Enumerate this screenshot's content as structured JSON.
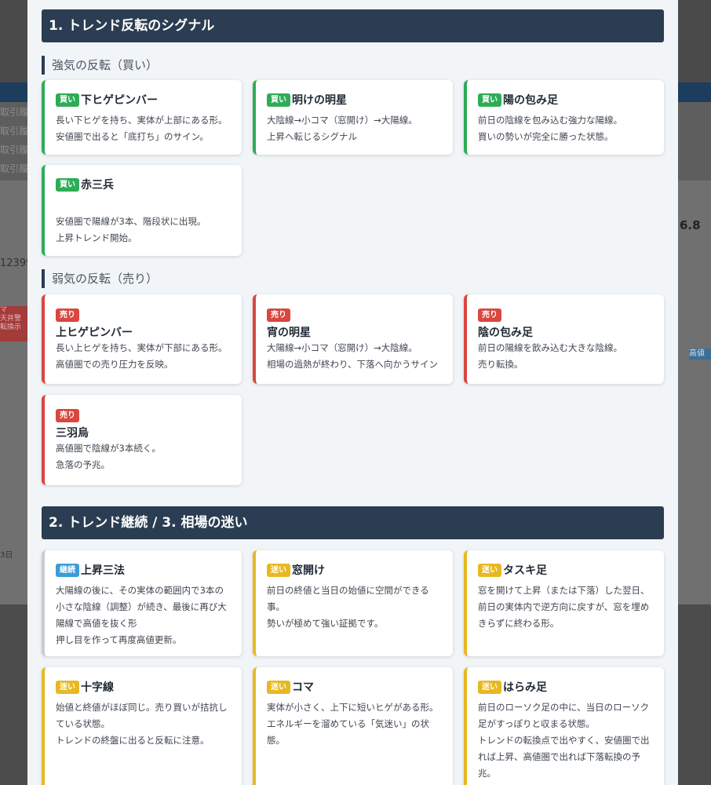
{
  "background": {
    "rows": [
      "取引履",
      "取引履",
      "取引履",
      "取引履"
    ],
    "left_number": "12399",
    "right_value": "6.8",
    "date_label": "3日",
    "left_tags": [
      "マ",
      "天井警",
      "転換示"
    ],
    "right_tag": "高値"
  },
  "section1": {
    "title": "1. トレンド反転のシグナル",
    "bull_heading": "強気の反転（買い）",
    "bear_heading": "弱気の反転（売り）"
  },
  "bull_cards": [
    {
      "badge": "買い",
      "title": "下ヒゲピンバー",
      "desc": "長い下ヒゲを持ち、実体が上部にある形。\n安値圏で出ると「底打ち」のサイン。"
    },
    {
      "badge": "買い",
      "title": "明けの明星",
      "desc": "大陰線→小コマ（窓開け）→大陽線。\n上昇へ転じるシグナル"
    },
    {
      "badge": "買い",
      "title": "陽の包み足",
      "desc": "前日の陰線を包み込む強力な陽線。\n買いの勢いが完全に勝った状態。"
    },
    {
      "badge": "買い",
      "title": "赤三兵",
      "desc": "安値圏で陽線が3本、階段状に出現。\n上昇トレンド開始。"
    }
  ],
  "bear_cards": [
    {
      "badge": "売り",
      "title": "上ヒゲピンバー",
      "desc": "長い上ヒゲを持ち、実体が下部にある形。\n高値圏での売り圧力を反映。"
    },
    {
      "badge": "売り",
      "title": "宵の明星",
      "desc": "大陽線→小コマ（窓開け）→大陰線。\n相場の過熱が終わり、下落へ向かうサイン"
    },
    {
      "badge": "売り",
      "title": "陰の包み足",
      "desc": "前日の陽線を飲み込む大きな陰線。\n売り転換。"
    },
    {
      "badge": "売り",
      "title": "三羽烏",
      "desc": "高値圏で陰線が3本続く。\n急落の予兆。"
    }
  ],
  "section2": {
    "title": "2. トレンド継続 / 3. 相場の迷い"
  },
  "other_cards": [
    {
      "badge": "継続",
      "title": "上昇三法",
      "desc": "大陽線の後に、その実体の範囲内で3本の\n小さな陰線（調整）が続き、最後に再び大\n陽線で高値を抜く形\n押し目を作って再度高値更新。"
    },
    {
      "badge": "迷い",
      "title": "窓開け",
      "desc": "前日の終値と当日の始値に空間ができる\n事。\n勢いが極めて強い証拠です。"
    },
    {
      "badge": "迷い",
      "title": "タスキ足",
      "desc": "窓を開けて上昇（または下落）した翌日、\n前日の実体内で逆方向に戻すが、窓を埋め\nきらずに終わる形。"
    },
    {
      "badge": "迷い",
      "title": "十字線",
      "desc": "始値と終値がほぼ同じ。売り買いが拮抗し\nている状態。\nトレンドの終盤に出ると反転に注意。"
    },
    {
      "badge": "迷い",
      "title": "コマ",
      "desc": "実体が小さく、上下に短いヒゲがある形。\nエネルギーを溜めている「気迷い」の状\n態。"
    },
    {
      "badge": "迷い",
      "title": "はらみ足",
      "desc": "前日のローソク足の中に、当日のローソク\n足がすっぽりと収まる状態。\nトレンドの転換点で出やすく、安値圏で出\nれば上昇、高値圏で出れば下落転換の予\n兆。"
    }
  ],
  "colors": {
    "header_bg": "#2b3d52",
    "buy": "#2eac56",
    "sell": "#d9473f",
    "continuation": "#3c9bd6",
    "indecision": "#e7b921"
  }
}
